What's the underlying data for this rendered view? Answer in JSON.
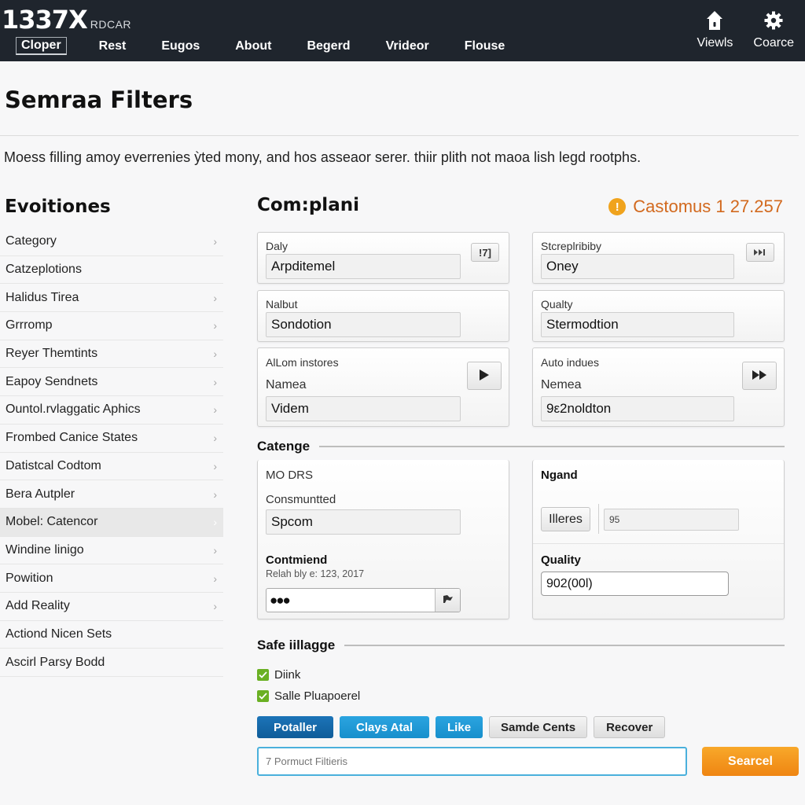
{
  "app": {
    "logo_main": "1337X",
    "logo_sub": "RDCAR"
  },
  "nav": {
    "items": [
      {
        "label": "Cloper",
        "active": true
      },
      {
        "label": "Rest"
      },
      {
        "label": "Eugos"
      },
      {
        "label": "About"
      },
      {
        "label": "Begerd"
      },
      {
        "label": "Vrideor"
      },
      {
        "label": "Flouse"
      }
    ],
    "actions": [
      {
        "label": "Viewls",
        "icon": "house-icon"
      },
      {
        "label": "Coarce",
        "icon": "gear-icon"
      }
    ]
  },
  "header": {
    "title": "Semraa Filters",
    "description": "Moess filling amoy everrenies ỳted mony, and hos asseaor serer. thiir plith not maoa lish legd rootphs."
  },
  "sidebar": {
    "title": "Evoitiones",
    "items": [
      {
        "label": "Category",
        "chevron": true
      },
      {
        "label": "Catzeplotions",
        "chevron": false
      },
      {
        "label": "Halidus Tirea",
        "chevron": true
      },
      {
        "label": "Grrromp",
        "chevron": true
      },
      {
        "label": "Reyer Themtints",
        "chevron": true
      },
      {
        "label": "Eapoy Sendnets",
        "chevron": true
      },
      {
        "label": "Ountol.rvlaggatic Aphics",
        "chevron": true
      },
      {
        "label": "Frombed Canice States",
        "chevron": true
      },
      {
        "label": "Datistcal Codtom",
        "chevron": true
      },
      {
        "label": "Bera Autpler",
        "chevron": true
      },
      {
        "label": "Mobel: Catencor",
        "chevron": true,
        "active": true
      },
      {
        "label": "Windine linigo",
        "chevron": true
      },
      {
        "label": "Powition",
        "chevron": true
      },
      {
        "label": "Add Reality",
        "chevron": true
      },
      {
        "label": "Actiond Nicen Sets",
        "chevron": false
      },
      {
        "label": "Ascirl Parsy Bodd",
        "chevron": false
      }
    ]
  },
  "main": {
    "title": "Com:plani",
    "status": {
      "icon": "warning-icon",
      "text": "Castomus 1 27.257",
      "color": "#d2691e"
    },
    "cards": {
      "daly": {
        "label": "Daly",
        "value": "Arpditemel",
        "button": "!7]"
      },
      "screplibiby": {
        "label": "Stcreplribiby",
        "value": "Oney",
        "button": "⏭"
      },
      "nalbut": {
        "label": "Nalbut",
        "value": "Sondotion"
      },
      "quality_top": {
        "label": "Qualty",
        "value": "Stermodtion"
      },
      "allom": {
        "label": "AlLom instores",
        "sublabel": "Namea",
        "value": "Videm",
        "button_icon": "play-icon"
      },
      "auto": {
        "label": "Auto indues",
        "sublabel": "Nemea",
        "value": "9ε2noldton",
        "button_icon": "fast-forward-icon"
      }
    },
    "section_category": {
      "title": "Catenge",
      "left": {
        "label": "MO DRS",
        "sublabel": "Consmuntted",
        "value": "Spcom",
        "bold_label": "Contmiend",
        "hint": "Relah bly e: 123, 2017",
        "password_mask": "●●●",
        "flag_icon": "flag-icon"
      },
      "right": {
        "label": "Ngand",
        "button": "Illeres",
        "field_value": "95",
        "bold_label": "Quality",
        "quality_value": "902(00l)"
      }
    },
    "section_safe": {
      "title": "Safe iillagge",
      "checkboxes": [
        {
          "label": "Diink",
          "checked": true
        },
        {
          "label": "Salle Pluapoerel",
          "checked": true
        }
      ]
    },
    "buttons": [
      {
        "label": "Potaller",
        "style": "dark"
      },
      {
        "label": "Clays Atal",
        "style": "mid"
      },
      {
        "label": "Like",
        "style": "mid"
      },
      {
        "label": "Samde Cents",
        "style": "gray"
      },
      {
        "label": "Recover",
        "style": "gray"
      }
    ],
    "search": {
      "placeholder": "7 Pormuct Filtieris",
      "button": "Searcel"
    }
  },
  "colors": {
    "topbar": "#1f252d",
    "accent_blue_dark": "#0f5c99",
    "accent_blue": "#178fcc",
    "search_orange": "#ef8512",
    "check_green": "#6ab023",
    "warning_orange": "#f0a31d"
  }
}
